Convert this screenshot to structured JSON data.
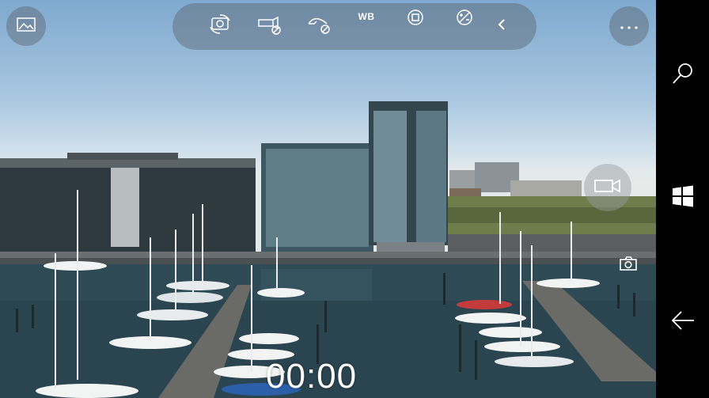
{
  "camera": {
    "timer": "00:00",
    "toolbar": {
      "white_balance_label": "WB"
    }
  },
  "icons": {
    "gallery": "image-icon",
    "switch_camera": "camera-switch-icon",
    "flash_off": "flash-off-icon",
    "hdr_off": "hdr-off-icon",
    "focus": "focus-icon",
    "exposure": "exposure-icon",
    "collapse": "chevron-left-icon",
    "more": "more-icon",
    "video_mode": "video-camera-icon",
    "photo_mode": "camera-icon",
    "search": "search-icon",
    "windows": "windows-icon",
    "back": "back-arrow-icon"
  },
  "colors": {
    "overlay": "#5a646e",
    "water": "#2e4a55",
    "sky": "#a9c7e0"
  }
}
